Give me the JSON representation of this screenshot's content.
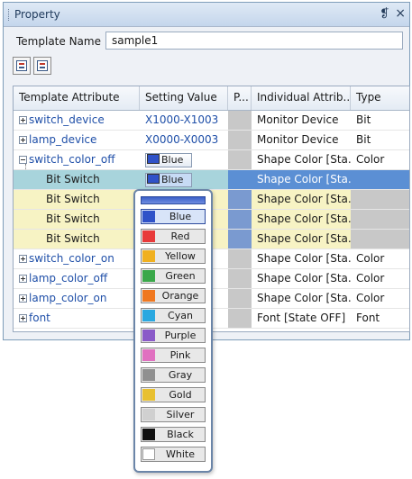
{
  "panel": {
    "title": "Property",
    "pin_glyph": "❡",
    "close_glyph": "×"
  },
  "template": {
    "label": "Template Name",
    "value": "sample1"
  },
  "toolbar": {
    "buttons": [
      "expand-all-icon",
      "collapse-all-icon"
    ]
  },
  "grid": {
    "columns": [
      "Template Attribute",
      "Setting Value",
      "P...",
      "Individual Attrib...",
      "Type"
    ],
    "rows": [
      {
        "attr": "switch_device",
        "value": "X1000-X1003",
        "individual": "Monitor Device",
        "type": "Bit"
      },
      {
        "attr": "lamp_device",
        "value": "X0000-X0003",
        "individual": "Monitor Device",
        "type": "Bit"
      },
      {
        "attr": "switch_color_off",
        "value": "Blue",
        "individual": "Shape Color [Sta...",
        "type": "Color"
      },
      {
        "attr": "Bit Switch",
        "value": "Blue",
        "individual": "Shape Color [Sta...",
        "type": ""
      },
      {
        "attr": "Bit Switch",
        "value": "",
        "individual": "Shape Color [Sta...",
        "type": ""
      },
      {
        "attr": "Bit Switch",
        "value": "",
        "individual": "Shape Color [Sta...",
        "type": ""
      },
      {
        "attr": "Bit Switch",
        "value": "",
        "individual": "Shape Color [Sta...",
        "type": ""
      },
      {
        "attr": "switch_color_on",
        "value": "",
        "individual": "Shape Color [Sta...",
        "type": "Color"
      },
      {
        "attr": "lamp_color_off",
        "value": "",
        "individual": "Shape Color [Sta...",
        "type": "Color"
      },
      {
        "attr": "lamp_color_on",
        "value": "",
        "individual": "Shape Color [Sta...",
        "type": "Color"
      },
      {
        "attr": "font",
        "value": "",
        "individual": "Font [State OFF]",
        "type": "Font"
      }
    ]
  },
  "dropdown": {
    "options": [
      {
        "label": "Blue",
        "color": "#2f52c8"
      },
      {
        "label": "Red",
        "color": "#e83a3a"
      },
      {
        "label": "Yellow",
        "color": "#f0b020"
      },
      {
        "label": "Green",
        "color": "#3aa84a"
      },
      {
        "label": "Orange",
        "color": "#f07820"
      },
      {
        "label": "Cyan",
        "color": "#2aa8e0"
      },
      {
        "label": "Purple",
        "color": "#8a5ac8"
      },
      {
        "label": "Pink",
        "color": "#e070c0"
      },
      {
        "label": "Gray",
        "color": "#909090"
      },
      {
        "label": "Gold",
        "color": "#e8c030"
      },
      {
        "label": "Silver",
        "color": "#d0d0d0"
      },
      {
        "label": "Black",
        "color": "#111111"
      },
      {
        "label": "White",
        "color": "#ffffff"
      }
    ]
  },
  "colors": {
    "selected_row": "#a8d4dc",
    "child_row": "#f7f3c4",
    "selected_value": "#5b8fd4"
  }
}
